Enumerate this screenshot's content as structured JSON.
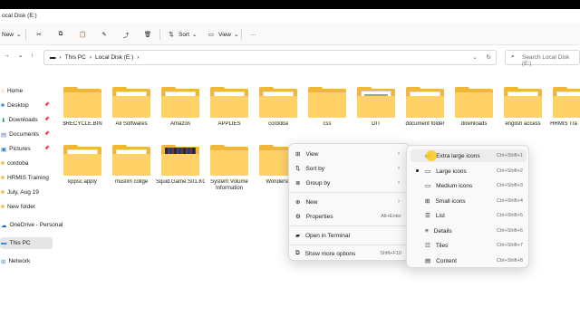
{
  "window": {
    "title": "ocal Disk (E:)"
  },
  "toolbar": {
    "new_label": "New",
    "sort_label": "Sort",
    "view_label": "View",
    "more_label": "···"
  },
  "nav": {
    "breadcrumbs": [
      "This PC",
      "Local Disk (E:)"
    ],
    "search_placeholder": "Search Local Disk (E:)"
  },
  "sidebar": {
    "items": [
      {
        "label": "Home"
      },
      {
        "label": "Desktop"
      },
      {
        "label": "Downloads"
      },
      {
        "label": "Documents"
      },
      {
        "label": "Pictures"
      },
      {
        "label": "cordoba"
      },
      {
        "label": "HRMIS Training"
      },
      {
        "label": "July, Aug 19"
      },
      {
        "label": "New folder"
      },
      {
        "label": "OneDrive - Personal"
      },
      {
        "label": "This PC"
      },
      {
        "label": "Network"
      }
    ]
  },
  "files": [
    {
      "label": "$RECYCLE.BIN"
    },
    {
      "label": "Ali Softwares"
    },
    {
      "label": "Amazon"
    },
    {
      "label": "APPLIES"
    },
    {
      "label": "cordoba"
    },
    {
      "label": "css"
    },
    {
      "label": "DIT"
    },
    {
      "label": "document folder"
    },
    {
      "label": "downloads"
    },
    {
      "label": "english access"
    },
    {
      "label": "HRMIS Tra"
    },
    {
      "label": "kppsc apply"
    },
    {
      "label": "muslim collge"
    },
    {
      "label": "Squid.Game.S01.KOREAN.720p.NF.WEBRip.DDP5.1.Atmos.x264-..."
    },
    {
      "label": "System Volume Information"
    },
    {
      "label": "Wondersh"
    }
  ],
  "context_menu": {
    "items": [
      {
        "label": "View"
      },
      {
        "label": "Sort by"
      },
      {
        "label": "Group by"
      },
      {
        "label": "New"
      },
      {
        "label": "Properties",
        "shortcut": "Alt+Enter"
      },
      {
        "label": "Open in Terminal"
      },
      {
        "label": "Show more options",
        "shortcut": "Shift+F10"
      }
    ]
  },
  "view_submenu": {
    "items": [
      {
        "label": "Extra large icons",
        "shortcut": "Ctrl+Shift+1"
      },
      {
        "label": "Large icons",
        "shortcut": "Ctrl+Shift+2"
      },
      {
        "label": "Medium icons",
        "shortcut": "Ctrl+Shift+3"
      },
      {
        "label": "Small icons",
        "shortcut": "Ctrl+Shift+4"
      },
      {
        "label": "List",
        "shortcut": "Ctrl+Shift+5"
      },
      {
        "label": "Details",
        "shortcut": "Ctrl+Shift+6"
      },
      {
        "label": "Tiles",
        "shortcut": "Ctrl+Shift+7"
      },
      {
        "label": "Content",
        "shortcut": "Ctrl+Shift+8"
      }
    ]
  },
  "colors": {
    "folder": "#f0b73a",
    "folder_front": "#ffd266",
    "accent": "#0067c0"
  }
}
